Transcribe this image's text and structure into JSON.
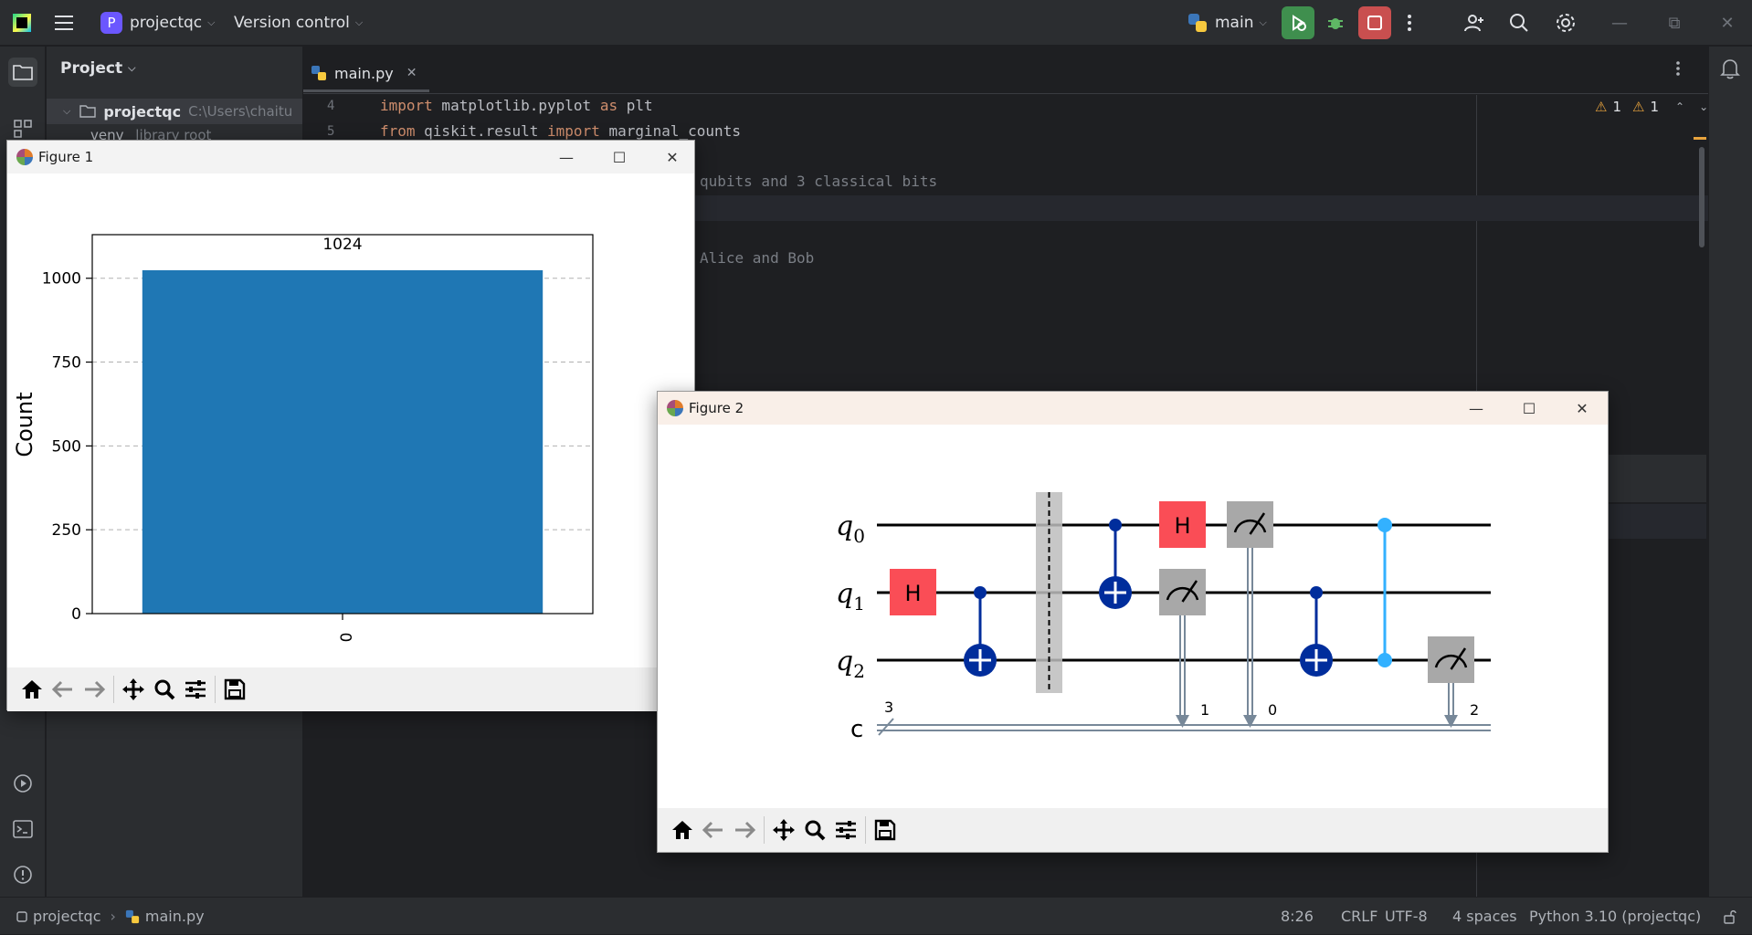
{
  "topbar": {
    "project_badge": "P",
    "project_name": "projectqc",
    "vcs_label": "Version control",
    "run_config": "main"
  },
  "project_panel": {
    "title": "Project",
    "root_name": "projectqc",
    "root_path": "C:\\Users\\chaitu",
    "child_name": "venv",
    "child_hint": "library root"
  },
  "editor": {
    "tab_name": "main.py",
    "warnings_a": "1",
    "warnings_b": "1",
    "lines": [
      {
        "num": "4",
        "kw1": "import",
        "rest1": " matplotlib.pyplot ",
        "kw2": "as",
        "rest2": " plt"
      },
      {
        "num": "5",
        "kw1": "from",
        "rest1": " qiskit.result ",
        "kw2": "import",
        "rest2": " marginal_counts"
      }
    ],
    "fragment_1": "qubits and 3 classical bits",
    "fragment_2": "Alice and Bob"
  },
  "figure1": {
    "title": "Figure 1"
  },
  "figure2": {
    "title": "Figure 2"
  },
  "chart_data": {
    "type": "bar",
    "categories": [
      "0"
    ],
    "values": [
      1024
    ],
    "data_labels": [
      "1024"
    ],
    "xlabel": "",
    "ylabel": "Count",
    "ylim": [
      0,
      1130
    ],
    "yticks": [
      0,
      250,
      500,
      750,
      1000
    ],
    "grid": "y dashed",
    "color": "#1f77b4"
  },
  "circuit": {
    "qubit_labels": [
      {
        "name": "q",
        "sub": "0"
      },
      {
        "name": "q",
        "sub": "1"
      },
      {
        "name": "q",
        "sub": "2"
      }
    ],
    "classical_label": "c",
    "classical_bits": "3",
    "gate_h": "H",
    "measure_targets": [
      "1",
      "0",
      "2"
    ],
    "colors": {
      "h_gate": "#fa4d56",
      "cnot": "#002d9c",
      "measure": "#a8a8a8",
      "cz": "#33b1ff"
    }
  },
  "statusbar": {
    "project": "projectqc",
    "file": "main.py",
    "position": "8:26",
    "line_sep": "CRLF",
    "encoding": "UTF-8",
    "indent": "4 spaces",
    "interpreter": "Python 3.10 (projectqc)"
  }
}
